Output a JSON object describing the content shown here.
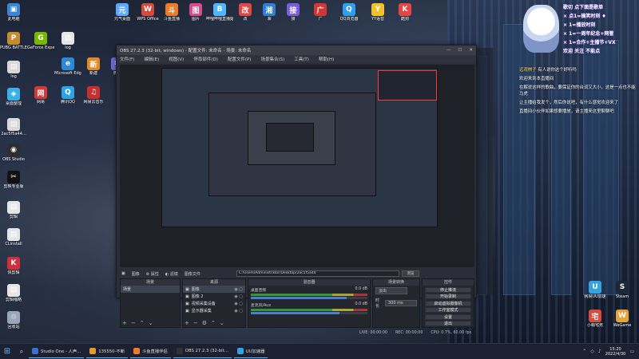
{
  "desktop_left_icons": [
    {
      "label": "此电脑",
      "color": "#3a86d6",
      "glyph": "▣"
    },
    {
      "label": "PUBG BATTLEGR...",
      "color": "#c58b2c",
      "glyph": "P"
    },
    {
      "label": "log",
      "color": "#d9d9d9",
      "glyph": "▤"
    },
    {
      "label": "桌面整理",
      "color": "#3ab0e5",
      "glyph": "◈"
    },
    {
      "label": "2ac5f5a44...",
      "color": "#d9d9d9",
      "glyph": "▤"
    },
    {
      "label": "OBS Studio",
      "color": "#2d2d2d",
      "glyph": "◉"
    },
    {
      "label": "剪映专业版",
      "color": "#111111",
      "glyph": "✂"
    },
    {
      "label": "剪辑",
      "color": "#e6e6e6",
      "glyph": "▤"
    },
    {
      "label": "CLinstall",
      "color": "#e6e6e6",
      "glyph": "▤"
    },
    {
      "label": "快剪辑",
      "color": "#d12e3e",
      "glyph": "K"
    },
    {
      "label": "剪辑缩略",
      "color": "#e6e6e6",
      "glyph": "▤"
    },
    {
      "label": "回收站",
      "color": "#9aa7b8",
      "glyph": "♲"
    }
  ],
  "desktop_top_icons": [
    {
      "label": "GeForce Experience",
      "color": "#76b900",
      "glyph": "G"
    },
    {
      "label": "log",
      "color": "#e6e6e6",
      "glyph": "▤"
    },
    {
      "label": "Microsoft Edge",
      "color": "#2b8ad6",
      "glyph": "e"
    },
    {
      "label": "腾讯QQ",
      "color": "#2aa4e6",
      "glyph": "Q"
    },
    {
      "label": "网易",
      "color": "#d23a3a",
      "glyph": "网"
    },
    {
      "label": "元气桌面",
      "color": "#5fa8ff",
      "glyph": "元"
    },
    {
      "label": "WPS Office",
      "color": "#d64a3a",
      "glyph": "W"
    },
    {
      "label": "斗鱼直播",
      "color": "#f07a28",
      "glyph": "斗"
    },
    {
      "label": "图片",
      "color": "#d94b8a",
      "glyph": "图"
    },
    {
      "label": "哔哩哔哩直播姬",
      "color": "#4db8ff",
      "glyph": "B"
    },
    {
      "label": "改",
      "color": "#e04848",
      "glyph": "改"
    },
    {
      "label": "湘",
      "color": "#2f7fd8",
      "glyph": "湘"
    },
    {
      "label": "接",
      "color": "#7b5ce0",
      "glyph": "接"
    },
    {
      "label": "广",
      "color": "#d43535",
      "glyph": "广"
    },
    {
      "label": "QQ浏览器",
      "color": "#2d9ff0",
      "glyph": "Q"
    },
    {
      "label": "YY语音",
      "color": "#f2c22a",
      "glyph": "Y"
    },
    {
      "label": "酷狗",
      "color": "#e64545",
      "glyph": "K"
    },
    {
      "label": "新建",
      "color": "#e08a2a",
      "glyph": "新"
    },
    {
      "label": "网易云音乐",
      "color": "#c82e2e",
      "glyph": "♫"
    },
    {
      "label": "微信",
      "color": "#6d6dd9",
      "glyph": "✉"
    }
  ],
  "desktop_right_icons": [
    {
      "label": "网易UU加速",
      "color": "#34a3e0",
      "glyph": "U"
    },
    {
      "label": "Steam",
      "color": "#1b2838",
      "glyph": "S"
    },
    {
      "label": "小萌宅男",
      "color": "#d44c3f",
      "glyph": "宅"
    },
    {
      "label": "WeGame",
      "color": "#e8a23a",
      "glyph": "W"
    }
  ],
  "overlay": {
    "lines": [
      "歌切 点下面是歌单",
      "× 点1=搞笑时刻 ♦",
      "× 1=播放时刻",
      "× 1=一周年纪念+网管",
      "× 1=合作+主播节+VX",
      "欢迎 关注 不能点"
    ]
  },
  "chat": {
    "messages": [
      {
        "user": "远观棋子",
        "text": "有人说你这个好听吗"
      },
      {
        "user": "",
        "text": "欢迎来到本直播间"
      },
      {
        "user": "",
        "text": "在解说这样的歌曲，要保证你的台词又大小，这是一点也不能马虎"
      },
      {
        "user": "",
        "text": "让主播给我发个，然后你说吧，有什么感觉欢迎来了"
      },
      {
        "user": "",
        "text": "直播间小伙伴如果想要播放，请主播来这里聊聊吧"
      }
    ]
  },
  "obs": {
    "title": "OBS 27.2.3 (32-bit, windows) - 配置文件: 未命名 - 场景: 未命名",
    "menu": [
      "文件(F)",
      "编辑(E)",
      "视图(V)",
      "停靠部件(D)",
      "配置文件(P)",
      "场景集合(S)",
      "工具(T)",
      "帮助(H)"
    ],
    "source_toolbar": {
      "source_name": "图像",
      "properties": "属性",
      "filters": "滤镜",
      "image_file": "图像文件"
    },
    "path_value": "C:/Users/Administrator/Desktop/2ac5f5a44",
    "browse": "浏览",
    "docks": {
      "scenes": {
        "title": "场景",
        "items": [
          "场景"
        ]
      },
      "sources": {
        "title": "来源",
        "items": [
          "图像",
          "图像 2",
          "视频采集设备",
          "显示器采集"
        ]
      },
      "mixer": {
        "title": "混音器",
        "channels": [
          {
            "name": "桌面音频",
            "db": "0.0 dB"
          },
          {
            "name": "麦克风/Aux",
            "db": "0.0 dB"
          }
        ]
      },
      "transitions": {
        "title": "场景转换",
        "type": "淡出",
        "duration_label": "时长",
        "duration": "300 ms"
      },
      "controls": {
        "title": "控件",
        "buttons": [
          "停止推流",
          "开始录制",
          "启动虚拟摄像机",
          "工作室模式",
          "设置",
          "退出"
        ]
      }
    },
    "status": {
      "live": "LIVE: 00:00:00",
      "rec": "REC: 00:00:00",
      "cpu": "CPU: 0.7%, 60.00 fps"
    }
  },
  "taskbar": {
    "items": [
      {
        "label": "Studio One - 人声...",
        "color": "#3c6fd0"
      },
      {
        "label": "135550-不断",
        "color": "#e09a2f"
      },
      {
        "label": "斗鱼直播伴侣",
        "color": "#f07a28"
      },
      {
        "label": "OBS 27.2.3 (32-bit...",
        "color": "#333333"
      },
      {
        "label": "UU加速器",
        "color": "#34a3e0"
      }
    ],
    "time": "15:20",
    "date": "2022/4/30"
  }
}
